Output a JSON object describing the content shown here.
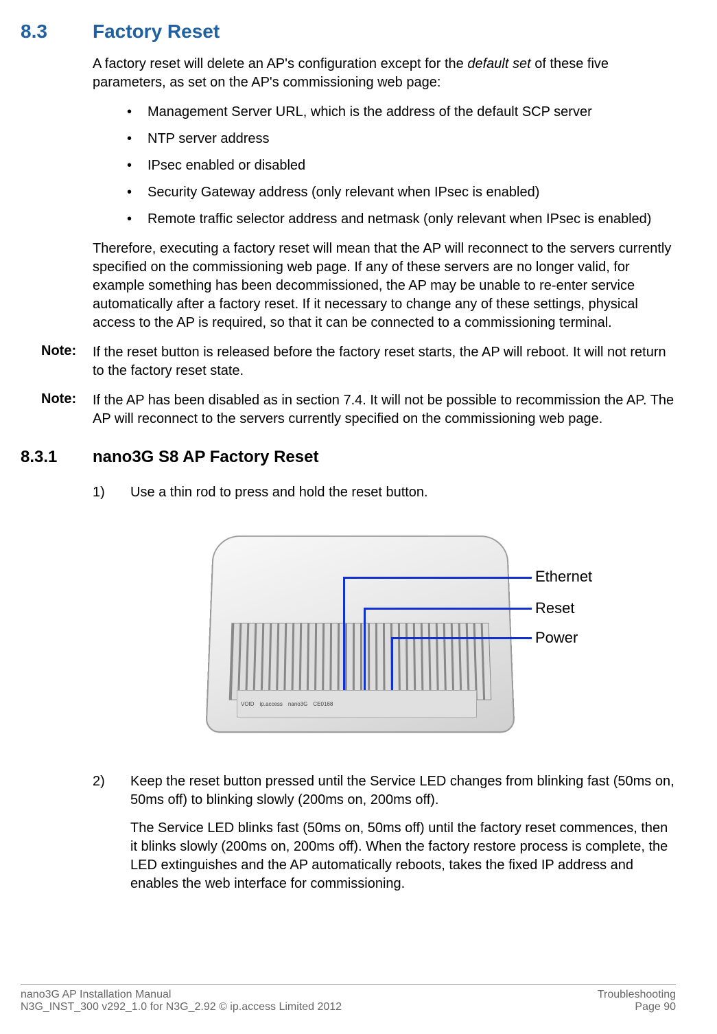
{
  "section": {
    "number": "8.3",
    "title": "Factory Reset",
    "intro_part1": "A factory reset will delete an AP's configuration except for the ",
    "intro_italic": "default set",
    "intro_part2": " of these five parameters, as set on the AP's commissioning web page:",
    "bullets": [
      "Management Server URL, which is the address of the default SCP server",
      "NTP server address",
      "IPsec enabled or disabled",
      "Security Gateway address (only relevant when IPsec is enabled)",
      "Remote traffic selector address and netmask (only relevant when IPsec is enabled)"
    ],
    "paragraph2": "Therefore, executing a factory reset will mean that the AP will reconnect to the servers currently specified on the commissioning web page. If any of these servers are no longer valid, for example something has been decommissioned, the AP may be unable to re-enter service automatically after a factory reset. If it necessary to change any of these settings, physical access to the AP is required, so that it can be connected to a commissioning terminal.",
    "note1_label": "Note:",
    "note1_text": "If the reset button is released before the factory reset starts, the AP will reboot. It will not return to the factory reset state.",
    "note2_label": "Note:",
    "note2_text": "If the AP has been disabled as in section 7.4. It will not be possible to recommission the AP. The AP will reconnect to the servers currently specified on the commissioning web page."
  },
  "subsection": {
    "number": "8.3.1",
    "title": "nano3G S8 AP Factory Reset",
    "step1_num": "1)",
    "step1_text": "Use a thin rod to press and hold the reset button.",
    "step2_num": "2)",
    "step2_text": "Keep the reset button pressed until the Service LED changes from blinking fast (50ms on, 50ms off) to blinking slowly (200ms on, 200ms off).",
    "step2_cont": "The Service LED blinks fast (50ms on, 50ms off) until the factory reset commences, then it blinks slowly (200ms on, 200ms off). When the factory restore process is complete, the LED extinguishes and the AP automatically reboots, takes the fixed IP address and enables the web interface for commissioning."
  },
  "figure": {
    "callouts": {
      "ethernet": "Ethernet",
      "reset": "Reset",
      "power": "Power"
    },
    "device_text": {
      "void": "VOID",
      "brand1": "ip.access",
      "brand2": "nano3G",
      "ce": "CE0168"
    }
  },
  "footer": {
    "left_line1": "nano3G AP Installation Manual",
    "left_line2": "N3G_INST_300 v292_1.0 for N3G_2.92 © ip.access Limited 2012",
    "right_line1": "Troubleshooting",
    "right_line2": "Page 90"
  }
}
